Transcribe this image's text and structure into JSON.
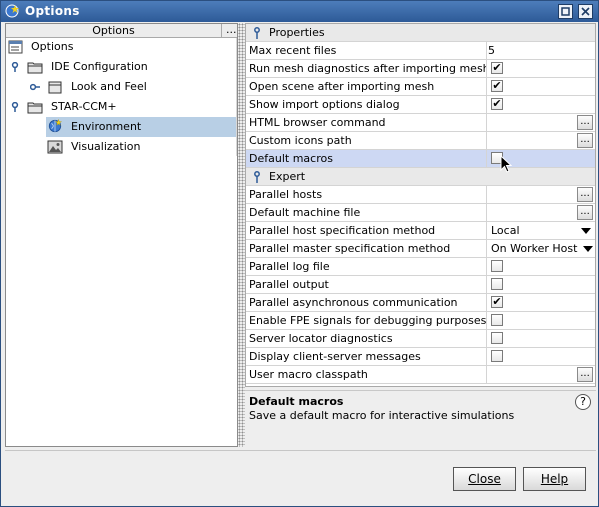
{
  "window": {
    "title": "Options"
  },
  "tree": {
    "header": "Options",
    "header_more": "...",
    "items": [
      {
        "label": "Options",
        "icon": "options-root-icon"
      },
      {
        "label": "IDE Configuration",
        "icon": "folder-icon"
      },
      {
        "label": "Look and Feel",
        "icon": "folder-icon"
      },
      {
        "label": "STAR-CCM+",
        "icon": "folder-icon"
      },
      {
        "label": "Environment",
        "icon": "environment-globe-icon"
      },
      {
        "label": "Visualization",
        "icon": "image-icon"
      }
    ]
  },
  "properties": {
    "category_properties": "Properties",
    "category_expert": "Expert",
    "rows": [
      {
        "name": "Max recent files",
        "value": "5"
      },
      {
        "name": "Run mesh diagnostics after importing mesh",
        "checked": true
      },
      {
        "name": "Open scene after importing mesh",
        "checked": true
      },
      {
        "name": "Show import options dialog",
        "checked": true
      },
      {
        "name": "HTML browser command",
        "value": ""
      },
      {
        "name": "Custom icons path",
        "value": ""
      },
      {
        "name": "Default macros",
        "checked": false
      }
    ],
    "expert_rows": [
      {
        "name": "Parallel hosts"
      },
      {
        "name": "Default machine file"
      },
      {
        "name": "Parallel host specification method",
        "value": "Local"
      },
      {
        "name": "Parallel master specification method",
        "value": "On Worker Host"
      },
      {
        "name": "Parallel log file",
        "checked": false
      },
      {
        "name": "Parallel output",
        "checked": false
      },
      {
        "name": "Parallel asynchronous communication",
        "checked": true
      },
      {
        "name": "Enable FPE signals for debugging purposes",
        "checked": false
      },
      {
        "name": "Server locator diagnostics",
        "checked": false
      },
      {
        "name": "Display client-server messages",
        "checked": false
      },
      {
        "name": "User macro classpath"
      }
    ],
    "ellipsis": "...",
    "check_mark": "✔"
  },
  "description": {
    "title": "Default macros",
    "text": "Save a default macro for interactive simulations",
    "help": "?"
  },
  "buttons": {
    "close": "Close",
    "help": "Help"
  },
  "colors": {
    "title_bar": "#3b6aa8",
    "selection": "#b8cfe5",
    "highlight_row": "#cdd8f3"
  }
}
